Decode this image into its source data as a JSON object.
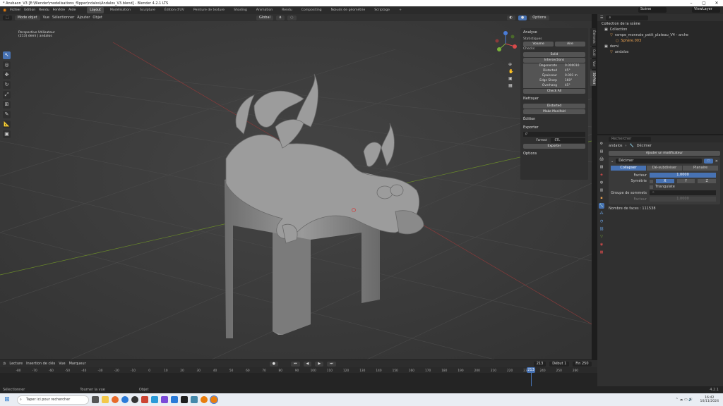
{
  "window": {
    "title": "* Ansbaon_V3 [E:\\Blender\\modelisations_flipper\\ndalos\\Andalos_V3.blend] - Blender 4.2.1 LTS"
  },
  "menu": [
    "Fichier",
    "Edition",
    "Rendu",
    "Fenêtre",
    "Aide"
  ],
  "workspaces": [
    "Layout",
    "Modélisation",
    "Sculpture",
    "Édition d'UV",
    "Peinture de texture",
    "Shading",
    "Animation",
    "Rendu",
    "Compositing",
    "Nœuds de géométrie",
    "Scriptage"
  ],
  "scene": {
    "label": "Scène",
    "layer": "ViewLayer"
  },
  "viewport": {
    "mode": "Mode objet",
    "menus": [
      "Vue",
      "Sélectionner",
      "Ajouter",
      "Objet"
    ],
    "transform": "Global",
    "options": "Options",
    "view_name": "Perspective Utilisateur",
    "view_sub": "(213) demi | andalos"
  },
  "npanel": {
    "section": "Analyse",
    "statistiques": "Statistiques",
    "volume": "Volume",
    "area": "Aire",
    "checks": "Checks",
    "solid": "Solid",
    "intersections": "Intersections",
    "rows": [
      {
        "k": "Degenerate",
        "v": "0.000010"
      },
      {
        "k": "Distorted",
        "v": "45°"
      },
      {
        "k": "Épaisseur",
        "v": "0.001 m"
      },
      {
        "k": "Edge Sharp",
        "v": "160°"
      },
      {
        "k": "Overhang",
        "v": "45°"
      }
    ],
    "check_all": "Check All",
    "nettoyer": "Nettoyer",
    "distorted_btn": "Distorted",
    "make_manifold": "Make Manifold",
    "edition": "Édition",
    "exporter": "Exporter",
    "path": "//",
    "format_label": "Format",
    "format_value": "STL",
    "export_btn": "Exporter",
    "options": "Options"
  },
  "tabs": [
    "Éléments",
    "Outil",
    "Vue",
    "3D-Print"
  ],
  "outliner": {
    "header": "Collection de la scène",
    "items": [
      {
        "name": "Collection",
        "indent": 0
      },
      {
        "name": "rampe_monnaie_petit_plateau_V4 - arche",
        "indent": 1
      },
      {
        "name": "Sphère.003",
        "indent": 2
      },
      {
        "name": "demi",
        "indent": 0
      },
      {
        "name": "andalos",
        "indent": 1
      }
    ]
  },
  "properties": {
    "search_placeholder": "Rechercher",
    "breadcrumb_obj": "andalos",
    "breadcrumb_mod": "Décimer",
    "add_modifier": "Ajouter un modificateur",
    "mod_name": "Décimer",
    "tabs": [
      "Collapser",
      "Dé-subdiviser",
      "Planaire"
    ],
    "facteur_label": "Facteur",
    "facteur_value": "1.0000",
    "symetrie_label": "Symétrie",
    "sym_axes": [
      "X",
      "Y",
      "Z"
    ],
    "triangulate": "Triangulate",
    "group_label": "Groupe de sommets",
    "facteur2_label": "Facteur",
    "facteur2_value": "1.0000",
    "face_count": "Nombre de faces : 111538"
  },
  "timeline": {
    "menus": [
      "Lecture",
      "Insertion de clés",
      "Vue",
      "Marqueur"
    ],
    "current": "213",
    "start_label": "Début",
    "start": "1",
    "end_label": "Fin",
    "end": "250",
    "ticks": [
      "-80",
      "-70",
      "-60",
      "-50",
      "-40",
      "-30",
      "-20",
      "-10",
      "0",
      "10",
      "20",
      "30",
      "40",
      "50",
      "60",
      "70",
      "80",
      "90",
      "100",
      "110",
      "120",
      "130",
      "140",
      "150",
      "160",
      "170",
      "180",
      "190",
      "200",
      "210",
      "220",
      "230",
      "240",
      "250",
      "260"
    ],
    "current_badge": "213"
  },
  "status": {
    "select": "Sélectionner",
    "rotate": "Tourner la vue",
    "object": "Objet",
    "version": "4.2.1"
  },
  "taskbar": {
    "search": "Taper ici pour rechercher",
    "time": "16:42",
    "date": "10/11/2024"
  }
}
